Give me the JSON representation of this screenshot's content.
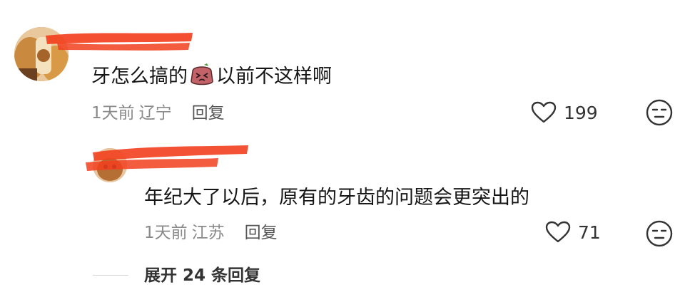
{
  "comments": [
    {
      "text_before_emoji": "牙怎么搞的",
      "emoji": "crying-face-emoji",
      "text_after_emoji": "以前不这样啊",
      "time": "1天前",
      "location": "辽宁",
      "reply_label": "回复",
      "likes": "199"
    },
    {
      "text": "年纪大了以后，原有的牙齿的问题会更突出的",
      "time": "1天前",
      "location": "江苏",
      "reply_label": "回复",
      "likes": "71"
    }
  ],
  "expand_replies_label": "展开 24 条回复",
  "colors": {
    "redaction": "#f2401e",
    "meta_gray": "#8a8a8a",
    "text": "#161616"
  }
}
